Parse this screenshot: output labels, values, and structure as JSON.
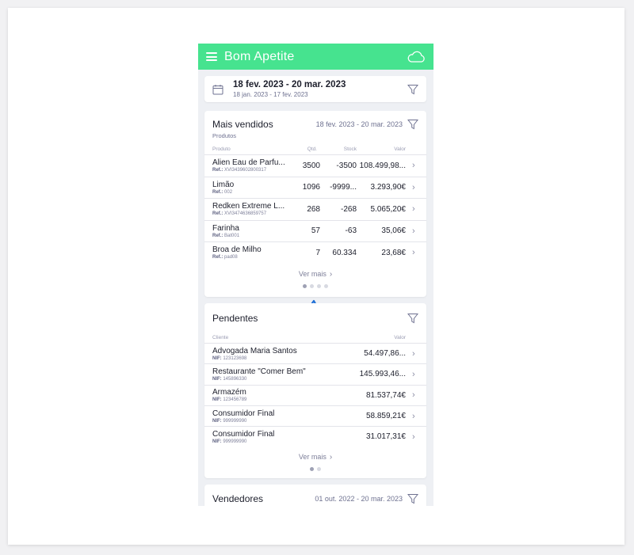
{
  "app": {
    "title": "Bom Apetite"
  },
  "date_range": {
    "main": "18 fev. 2023 - 20 mar. 2023",
    "compare": "18 jan. 2023 - 17 fev. 2023"
  },
  "mais_vendidos": {
    "title": "Mais vendidos",
    "subtitle": "Produtos",
    "range": "18 fev. 2023 - 20 mar. 2023",
    "columns": {
      "produto": "Produto",
      "qtd": "Qtd.",
      "stock": "Stock",
      "valor": "Valor"
    },
    "rows": [
      {
        "name": "Alien Eau de Parfu...",
        "ref_label": "Ref.:",
        "ref": "XVI3439602800317",
        "qtd": "3500",
        "stock": "-3500",
        "valor": "108.499,98..."
      },
      {
        "name": "Limão",
        "ref_label": "Ref.:",
        "ref": "002",
        "qtd": "1096",
        "stock": "-9999...",
        "valor": "3.293,90€"
      },
      {
        "name": "Redken Extreme L...",
        "ref_label": "Ref.:",
        "ref": "XVI3474636859757",
        "qtd": "268",
        "stock": "-268",
        "valor": "5.065,20€"
      },
      {
        "name": "Farinha",
        "ref_label": "Ref.:",
        "ref": "Bat001",
        "qtd": "57",
        "stock": "-63",
        "valor": "35,06€"
      },
      {
        "name": "Broa de Milho",
        "ref_label": "Ref.:",
        "ref": "pad08",
        "qtd": "7",
        "stock": "60.334",
        "valor": "23,68€"
      }
    ],
    "ver_mais": "Ver mais",
    "page_dots": 4,
    "active_dot": 0
  },
  "pendentes": {
    "title": "Pendentes",
    "columns": {
      "cliente": "Cliente",
      "valor": "Valor"
    },
    "rows": [
      {
        "name": "Advogada Maria Santos",
        "nif_label": "NIF:",
        "nif": "123123698",
        "valor": "54.497,86..."
      },
      {
        "name": "Restaurante \"Comer Bem\"",
        "nif_label": "NIF:",
        "nif": "145896330",
        "valor": "145.993,46..."
      },
      {
        "name": "Armazém",
        "nif_label": "NIF:",
        "nif": "123456789",
        "valor": "81.537,74€"
      },
      {
        "name": "Consumidor Final",
        "nif_label": "NIF:",
        "nif": "999999990",
        "valor": "58.859,21€"
      },
      {
        "name": "Consumidor Final",
        "nif_label": "NIF:",
        "nif": "999999990",
        "valor": "31.017,31€"
      }
    ],
    "ver_mais": "Ver mais",
    "page_dots": 2,
    "active_dot": 0
  },
  "vendedores": {
    "title": "Vendedores",
    "range": "01 out. 2022 - 20 mar. 2023"
  },
  "colors": {
    "accent": "#46e38f",
    "annotation_arrow": "#1f6fd6"
  }
}
